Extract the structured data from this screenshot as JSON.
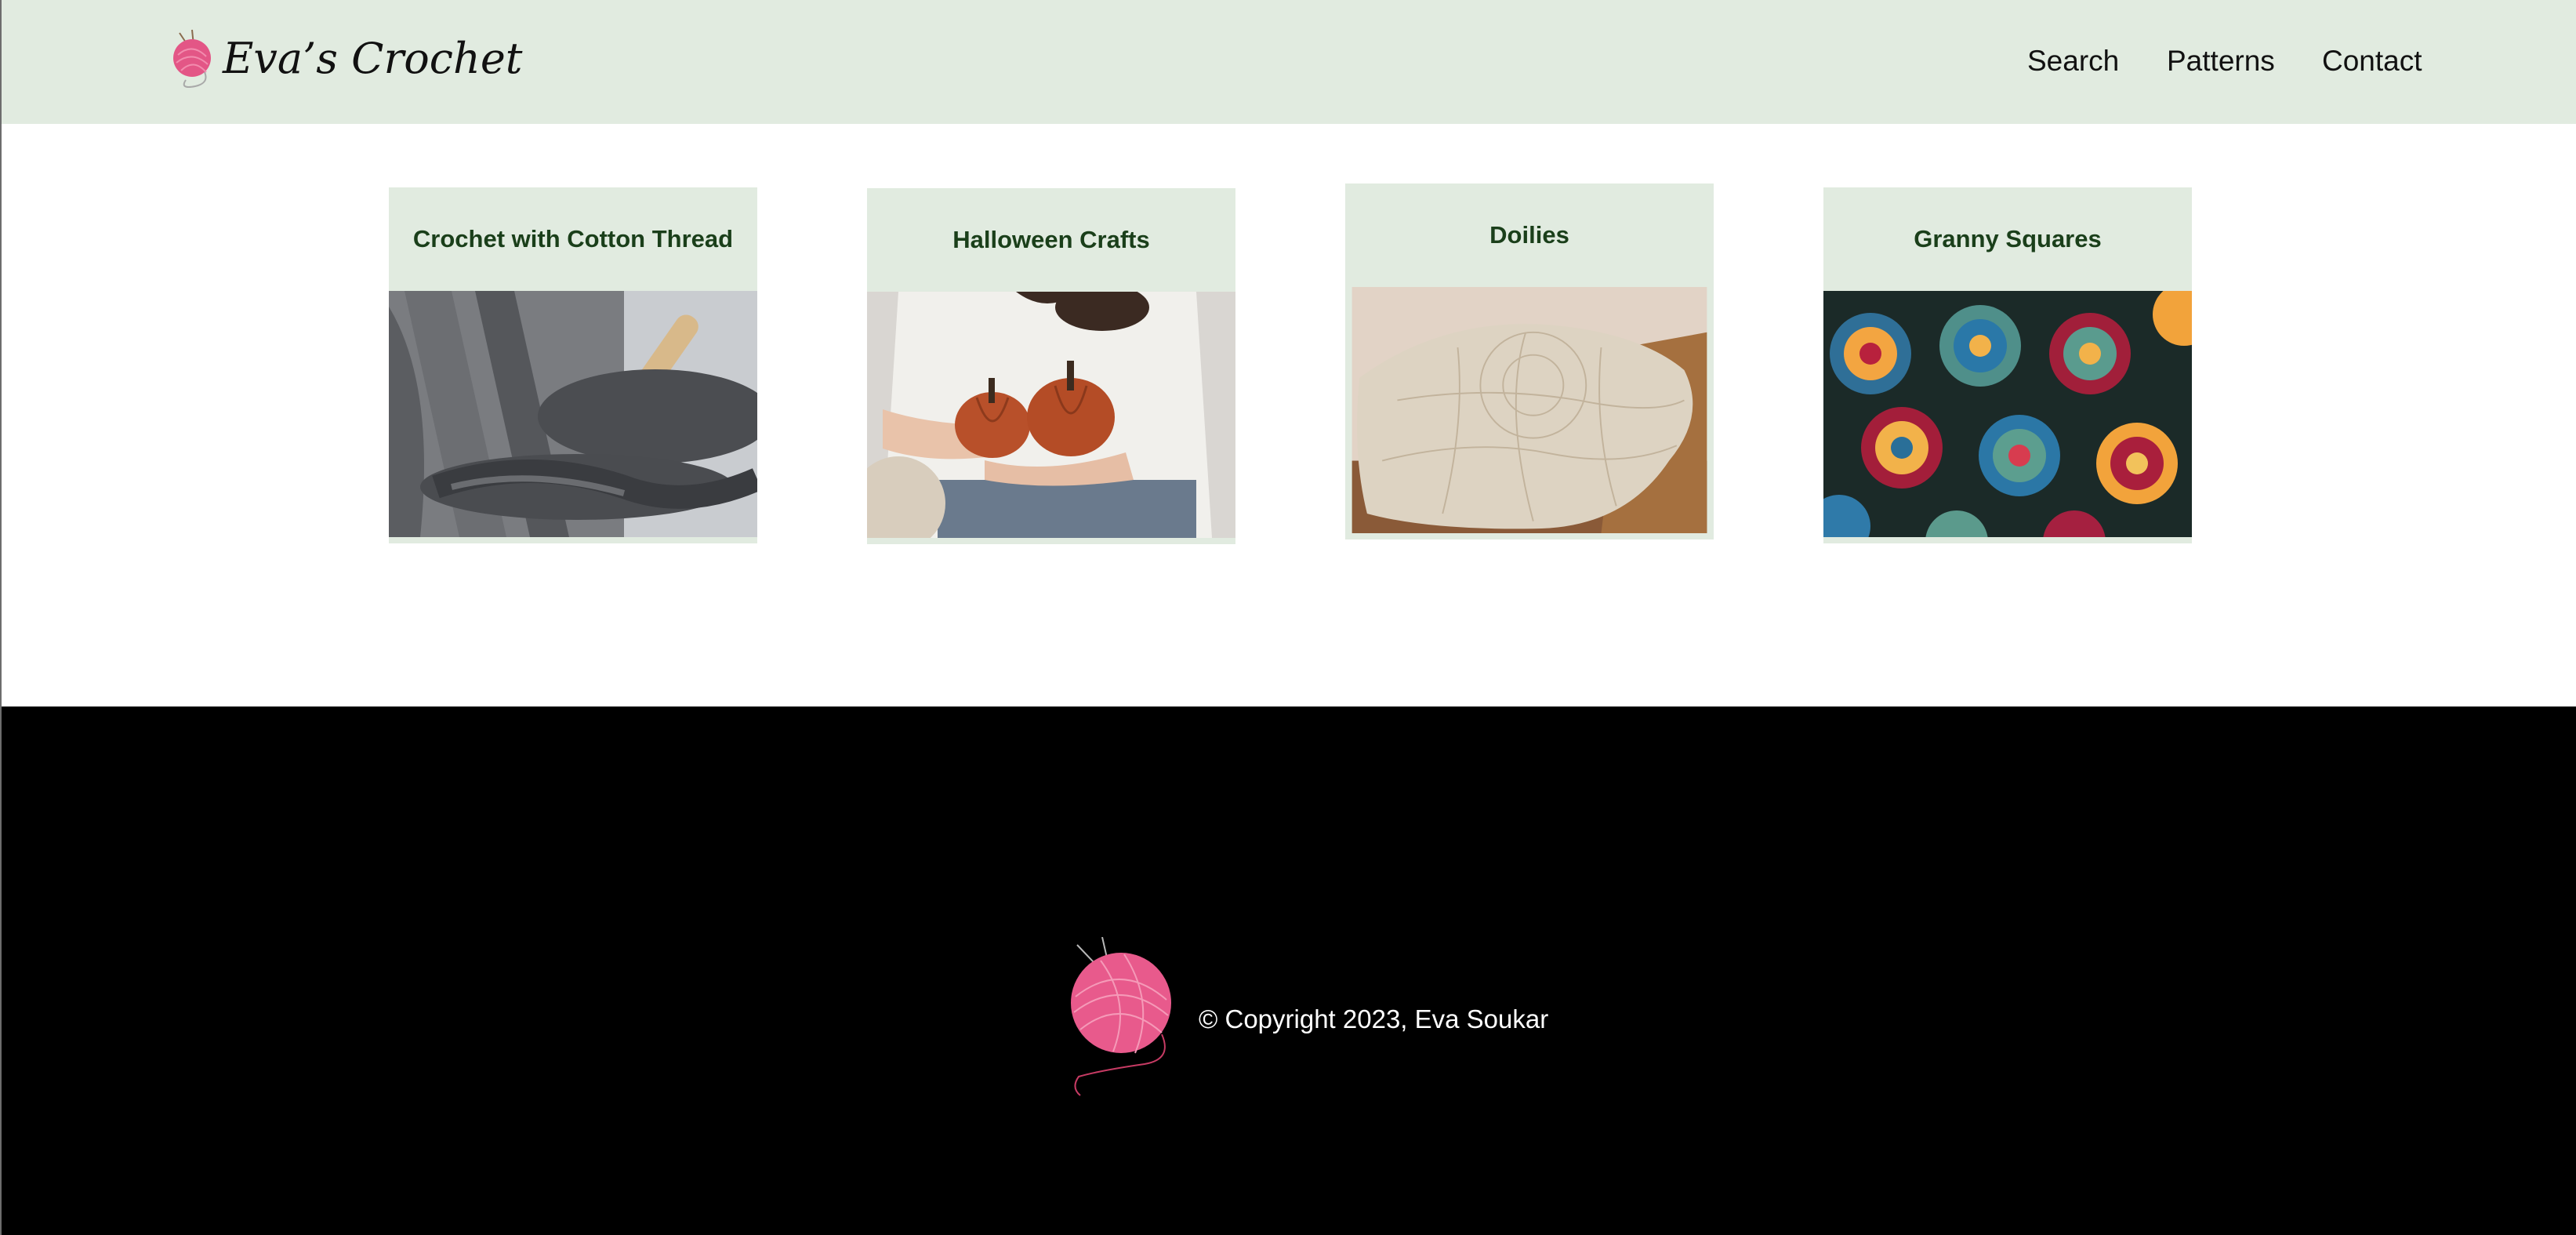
{
  "site": {
    "brand": "Eva’s Crochet"
  },
  "nav": {
    "search": "Search",
    "patterns": "Patterns",
    "contact": "Contact"
  },
  "cards": [
    {
      "title": "Crochet with Cotton Thread"
    },
    {
      "title": "Halloween Crafts"
    },
    {
      "title": "Doilies"
    },
    {
      "title": "Granny Squares"
    }
  ],
  "footer": {
    "copyright": "© Copyright 2023, Eva Soukar"
  },
  "colors": {
    "header_bg": "#e1ebe0",
    "card_title": "#1a3f1a",
    "footer_bg": "#000000",
    "yarn_pink": "#e35686"
  },
  "icons": {
    "logo": "yarn-ball-icon"
  }
}
